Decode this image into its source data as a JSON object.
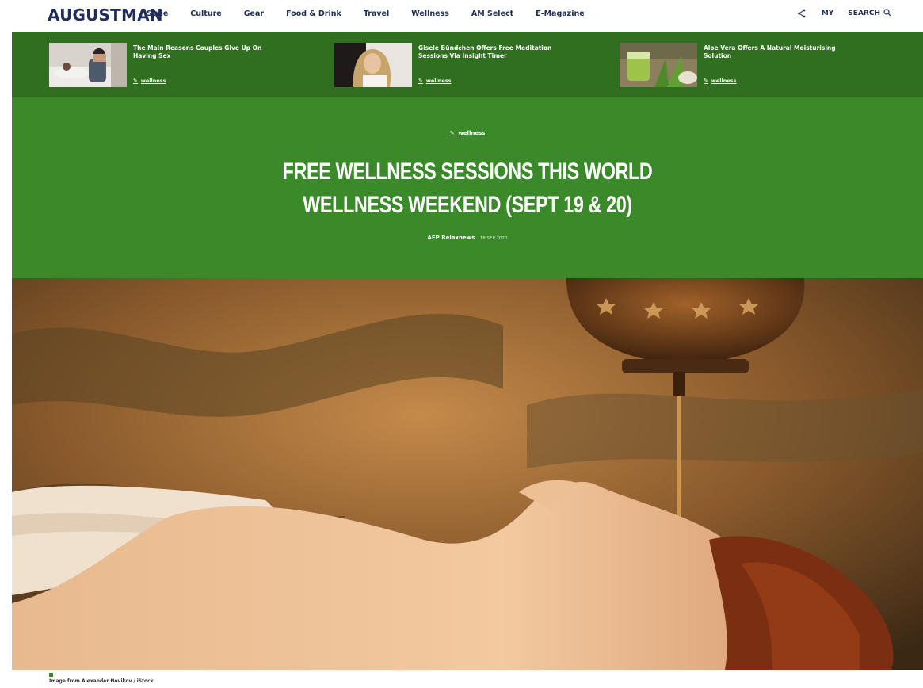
{
  "header": {
    "logo": "AUGUSTMAN",
    "nav": [
      "Style",
      "Culture",
      "Gear",
      "Food & Drink",
      "Travel",
      "Wellness",
      "AM Select",
      "E-Magazine"
    ],
    "my_label": "MY",
    "search_label": "SEARCH"
  },
  "related": [
    {
      "title": "The Main Reasons Couples Give Up On Having Sex",
      "tag": "wellness"
    },
    {
      "title": "Gisele Bündchen Offers Free Meditation Sessions Via Insight Timer",
      "tag": "wellness"
    },
    {
      "title": "Aloe Vera Offers A Natural Moisturising Solution",
      "tag": "wellness"
    }
  ],
  "article": {
    "category": "wellness",
    "title_line1": "FREE WELLNESS SESSIONS THIS WORLD",
    "title_line2": "WELLNESS WEEKEND (SEPT 19 & 20)",
    "author": "AFP Relaxnews",
    "date": "18 SEP 2020",
    "caption": "Image from Alexander Novikov / iStock"
  },
  "colors": {
    "brand_navy": "#1f2d5a",
    "strip_green": "#2f6f1f",
    "hero_green": "#3a8a2a"
  }
}
